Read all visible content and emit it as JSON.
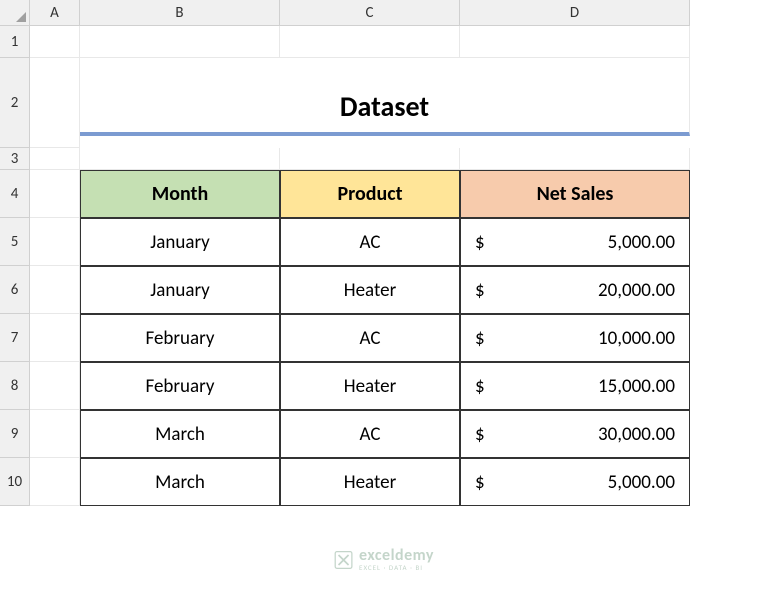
{
  "columns": [
    "A",
    "B",
    "C",
    "D"
  ],
  "rows": [
    "1",
    "2",
    "3",
    "4",
    "5",
    "6",
    "7",
    "8",
    "9",
    "10"
  ],
  "title": "Dataset",
  "headers": {
    "month": "Month",
    "product": "Product",
    "sales": "Net Sales"
  },
  "currency": "$",
  "data": [
    {
      "month": "January",
      "product": "AC",
      "sales": "5,000.00"
    },
    {
      "month": "January",
      "product": "Heater",
      "sales": "20,000.00"
    },
    {
      "month": "February",
      "product": "AC",
      "sales": "10,000.00"
    },
    {
      "month": "February",
      "product": "Heater",
      "sales": "15,000.00"
    },
    {
      "month": "March",
      "product": "AC",
      "sales": "30,000.00"
    },
    {
      "month": "March",
      "product": "Heater",
      "sales": "5,000.00"
    }
  ],
  "watermark": {
    "main": "exceldemy",
    "sub": "EXCEL · DATA · BI"
  },
  "chart_data": {
    "type": "table",
    "title": "Dataset",
    "columns": [
      "Month",
      "Product",
      "Net Sales"
    ],
    "rows": [
      [
        "January",
        "AC",
        5000.0
      ],
      [
        "January",
        "Heater",
        20000.0
      ],
      [
        "February",
        "AC",
        10000.0
      ],
      [
        "February",
        "Heater",
        15000.0
      ],
      [
        "March",
        "AC",
        30000.0
      ],
      [
        "March",
        "Heater",
        5000.0
      ]
    ],
    "currency": "USD"
  }
}
